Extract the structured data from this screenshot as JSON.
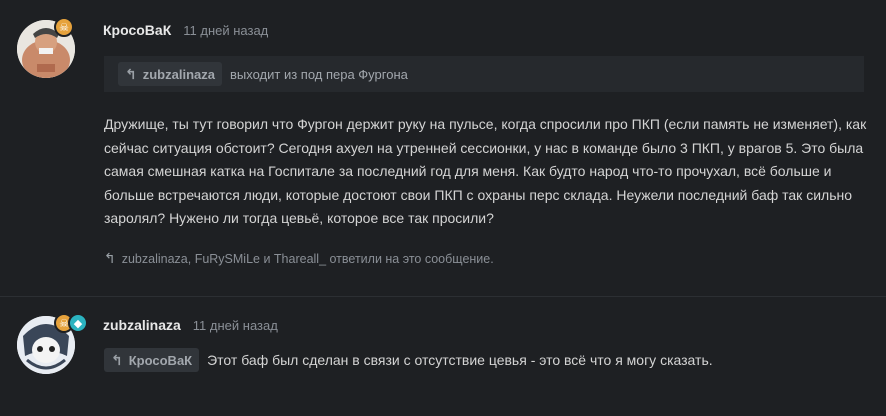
{
  "post1": {
    "author": "КросоВаК",
    "time": "11 дней назад",
    "quote_user": "zubzalinaza",
    "quote_text": "выходит из под пера Фургона",
    "body": "Дружище, ты тут говорил что Фургон держит руку на пульсе, когда спросили про ПКП (если память не изменяет), как сейчас ситуация обстоит? Сегодня ахуел на утренней сессионки, у нас в команде было 3 ПКП, у врагов 5. Это была самая смешная катка на Госпитале за последний год для меня. Как будто народ что-то прочухал, всё больше и больше встречаются люди, которые достоют свои ПКП с охраны перс склада. Неужели последний баф так сильно заролял? Нужено ли тогда цевьё, которое все так просили?",
    "replies": "zubzalinaza, FuRySMiLe и Thareall_ ответили на это сообщение."
  },
  "post2": {
    "author": "zubzalinaza",
    "time": "11 дней назад",
    "quote_user": "КросоВаК",
    "text": "Этот баф был сделан в связи с отсутствие цевья - это всё что я могу сказать."
  },
  "icons": {
    "reply": "reply-arrow-icon",
    "badge1": "skull-badge-icon",
    "badge2": "diamond-badge-icon"
  },
  "colors": {
    "background": "#1e2023",
    "quote_bg": "#26292d",
    "chip_bg": "#31353a",
    "badge_gold": "#e6a23c",
    "badge_teal": "#2bb3c0"
  }
}
